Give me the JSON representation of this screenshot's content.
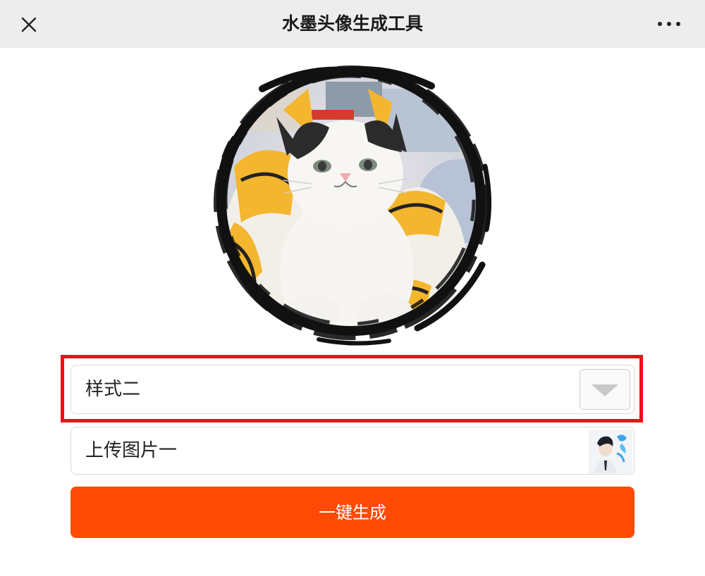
{
  "header": {
    "title": "水墨头像生成工具",
    "close_icon": "close-icon",
    "more_icon": "more-icon"
  },
  "avatar": {
    "icon": "ink-brush-circle-cat-avatar"
  },
  "style_select": {
    "value": "样式二",
    "arrow_icon": "triangle-down-icon",
    "highlight_color": "#e8121a"
  },
  "upload": {
    "label": "上传图片一",
    "thumb_icon": "uploaded-photo-thumbnail"
  },
  "generate": {
    "label": "一键生成",
    "color": "#ff4a05"
  }
}
